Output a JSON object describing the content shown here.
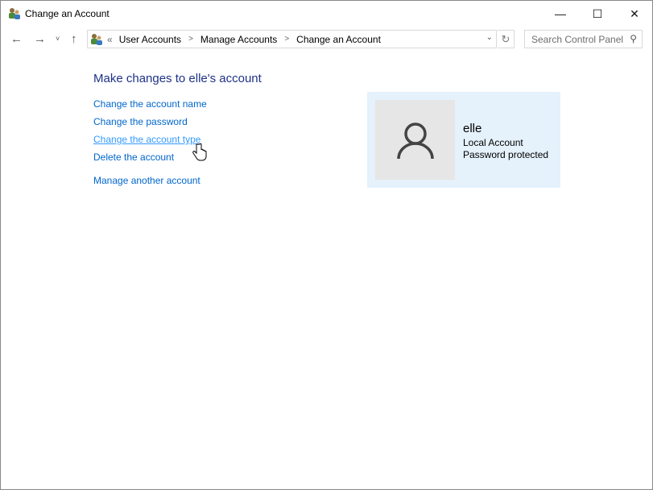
{
  "window": {
    "title": "Change an Account",
    "minimize": "—",
    "maximize": "☐",
    "close": "✕"
  },
  "address": {
    "prefix": "«",
    "crumbs": [
      "User Accounts",
      "Manage Accounts",
      "Change an Account"
    ],
    "search_placeholder": "Search Control Panel"
  },
  "main": {
    "heading": "Make changes to elle's account",
    "links": [
      "Change the account name",
      "Change the password",
      "Change the account type",
      "Delete the account",
      "Manage another account"
    ]
  },
  "account": {
    "name": "elle",
    "type": "Local Account",
    "status": "Password protected"
  }
}
